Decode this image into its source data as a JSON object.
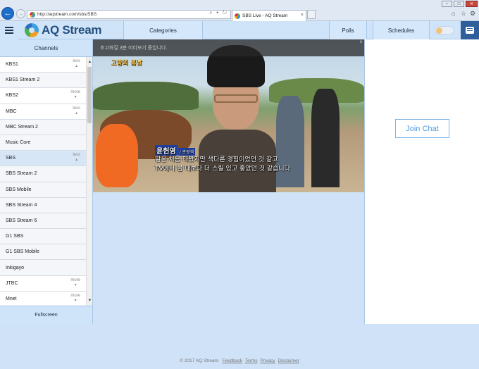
{
  "browser": {
    "url": "http://aqstream.com/sbs/SBS",
    "tab_title": "SBS Live - AQ Stream",
    "tab_close": "×",
    "addr_tools": "⌕ ▾ ↻",
    "back_glyph": "←",
    "forward_glyph": "→",
    "window_min": "–",
    "window_max": "□",
    "window_close": "✕",
    "home_glyph": "⌂",
    "star_glyph": "☆",
    "gear_glyph": "⚙"
  },
  "header": {
    "logo_text": "AQ Stream",
    "categories_label": "Categories",
    "polls_label": "Polls",
    "schedules_label": "Schedules"
  },
  "sidebar": {
    "title": "Channels",
    "footer_label": "Fullscreen",
    "items": [
      {
        "label": "KBS1",
        "toggle": "less"
      },
      {
        "label": "KBS1 Stream 2",
        "toggle": ""
      },
      {
        "label": "KBS2",
        "toggle": "more"
      },
      {
        "label": "MBC",
        "toggle": "less"
      },
      {
        "label": "MBC Stream 2",
        "toggle": ""
      },
      {
        "label": "Music Core",
        "toggle": ""
      },
      {
        "label": "SBS",
        "toggle": "less"
      },
      {
        "label": "SBS Stream 2",
        "toggle": ""
      },
      {
        "label": "SBS Mobile",
        "toggle": ""
      },
      {
        "label": "SBS Stream 4",
        "toggle": ""
      },
      {
        "label": "SBS Stream 6",
        "toggle": ""
      },
      {
        "label": "G1 SBS",
        "toggle": ""
      },
      {
        "label": "G1 SBS Mobile",
        "toggle": ""
      },
      {
        "label": "Inkigayo",
        "toggle": ""
      },
      {
        "label": "JTBC",
        "toggle": "more"
      },
      {
        "label": "Mnet",
        "toggle": "more"
      }
    ]
  },
  "video": {
    "notice": "초고화질 3분 미리보기 중입니다.",
    "close_glyph": "x",
    "show_logo": "고향의 봄날",
    "caption_name": "윤헌영",
    "caption_role": "/ 관광객",
    "caption_line1": "말을 처음 타봤지만 색다른 경험이었던 것 같고",
    "caption_line2": "TV에서 볼 때보다 더 스릴 있고 좋았던 것 같습니다"
  },
  "chat": {
    "join_label": "Join Chat"
  },
  "footer": {
    "copyright": "© 2017 AQ Stream.",
    "links": [
      "Feedback",
      "Terms",
      "Privacy",
      "Disclaimer"
    ]
  },
  "colors": {
    "accent": "#2e5f9a",
    "header_bg": "#d0e4f9",
    "join_chat": "#4b9ae0"
  }
}
